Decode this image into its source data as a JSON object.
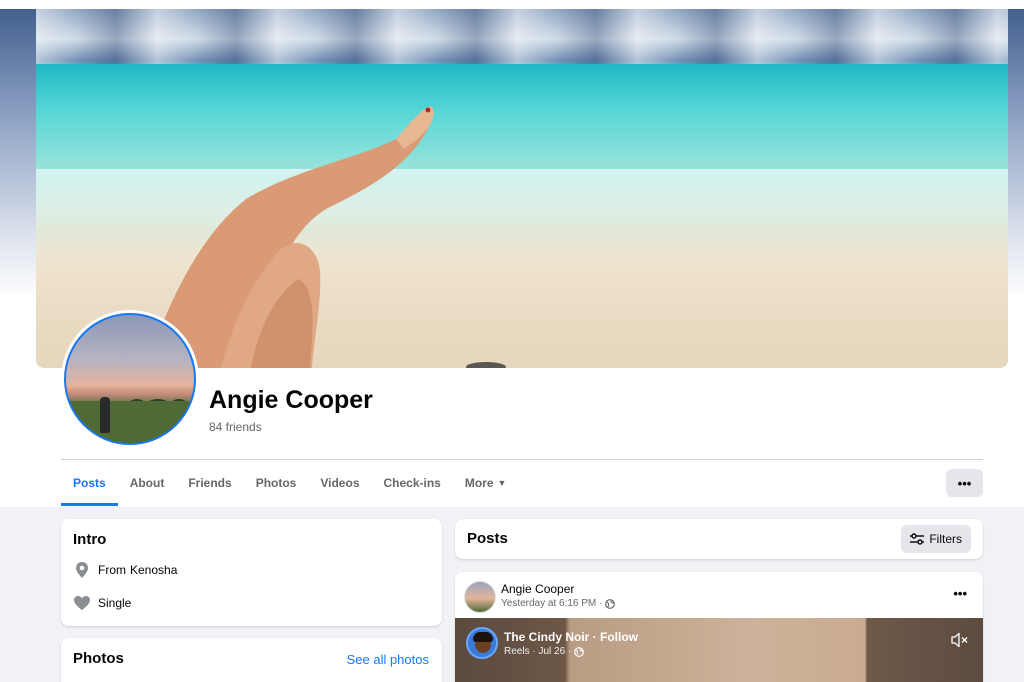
{
  "profile": {
    "name": "Angie Cooper",
    "friends_count": "84 friends"
  },
  "tabs": [
    {
      "label": "Posts",
      "active": true
    },
    {
      "label": "About"
    },
    {
      "label": "Friends"
    },
    {
      "label": "Photos"
    },
    {
      "label": "Videos"
    },
    {
      "label": "Check-ins"
    },
    {
      "label": "More"
    }
  ],
  "header_more_button": "•••",
  "intro": {
    "title": "Intro",
    "from_prefix": "From",
    "from_place": "Kenosha",
    "relationship": "Single"
  },
  "photos": {
    "title": "Photos",
    "see_all": "See all photos"
  },
  "posts": {
    "title": "Posts",
    "filters_label": "Filters"
  },
  "post": {
    "author": "Angie Cooper",
    "time": "Yesterday at 6:16 PM ·",
    "more": "•••",
    "shared_reel": {
      "title": "The Cindy Noir · Follow",
      "sub": "Reels · Jul 26 ·"
    }
  },
  "icons": {
    "location": "map-pin-icon",
    "relationship": "heart-icon",
    "filters": "sliders-icon",
    "privacy": "globe-icon",
    "mute": "speaker-muted-icon",
    "tab_more_caret": "caret-down-icon"
  },
  "colors": {
    "accent": "#1877f2",
    "background": "#f0f2f5",
    "secondary_text": "#65676b"
  }
}
